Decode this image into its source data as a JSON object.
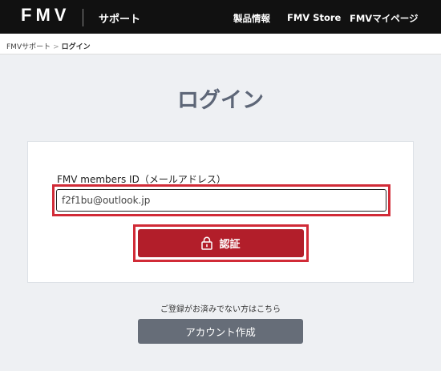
{
  "header": {
    "logo": "FMV",
    "section": "サポート",
    "nav": [
      "製品情報",
      "FMV Store",
      "FMVマイページ"
    ]
  },
  "breadcrumb": {
    "items": [
      "FMVサポート",
      "ログイン"
    ],
    "separator": ">"
  },
  "page": {
    "title": "ログイン"
  },
  "login_form": {
    "field_label": "FMV members ID（メールアドレス）",
    "email_value": "f2f1bu@outlook.jp",
    "submit_label": "認証",
    "submit_icon": "lock-icon"
  },
  "register": {
    "note": "ご登録がお済みでない方はこちら",
    "button_label": "アカウント作成"
  },
  "colors": {
    "header_bg": "#111111",
    "accent_red": "#b21e2a",
    "highlight_red": "#d12b37",
    "secondary_button": "#666d78",
    "page_bg": "#eef0f3"
  }
}
